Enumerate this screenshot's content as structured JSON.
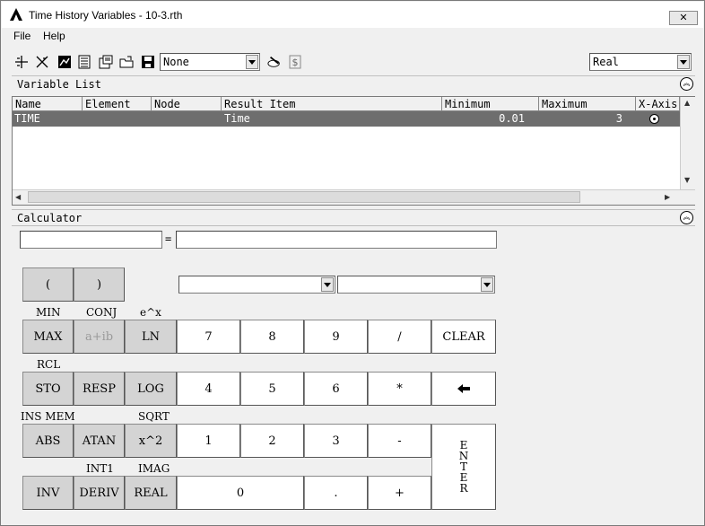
{
  "window": {
    "title": "Time History Variables - 10-3.rth",
    "close_glyph": "✕"
  },
  "menu": {
    "items": [
      "File",
      "Help"
    ]
  },
  "toolbar": {
    "variable_select": "None",
    "mode_select": "Real",
    "icons": [
      "add-variable-icon",
      "delete-variable-icon",
      "graph-icon",
      "list-icon",
      "properties-icon",
      "import-icon",
      "save-icon",
      "edit-icon",
      "dollar-icon"
    ]
  },
  "variable_list": {
    "header": "Variable List",
    "columns": [
      "Name",
      "Element",
      "Node",
      "Result Item",
      "Minimum",
      "Maximum",
      "X-Axis"
    ],
    "rows": [
      {
        "name": "TIME",
        "element": "",
        "node": "",
        "result_item": "Time",
        "minimum": "0.01",
        "maximum": "3",
        "x_axis": true
      }
    ]
  },
  "calculator": {
    "header": "Calculator",
    "expression_value": "",
    "equals_sign": "=",
    "result_value": "",
    "selector_left": "",
    "selector_right": "",
    "keys": {
      "lparen": "(",
      "rparen": ")",
      "max": "MAX",
      "aib": "a+ib",
      "ln": "LN",
      "sto": "STO",
      "resp": "RESP",
      "log": "LOG",
      "abs": "ABS",
      "atan": "ATAN",
      "x2": "x^2",
      "inv": "INV",
      "deriv": "DERIV",
      "real": "REAL",
      "n7": "7",
      "n8": "8",
      "n9": "9",
      "div": "/",
      "clear": "CLEAR",
      "n4": "4",
      "n5": "5",
      "n6": "6",
      "mul": "*",
      "n1": "1",
      "n2": "2",
      "n3": "3",
      "minus": "-",
      "n0": "0",
      "dot": ".",
      "plus": "+",
      "enter": [
        "E",
        "N",
        "T",
        "E",
        "R"
      ]
    },
    "shift_labels": {
      "min": "MIN",
      "conj": "CONJ",
      "ex": "e^x",
      "rcl": "RCL",
      "insmem": "INS MEM",
      "sqrt": "SQRT",
      "int1": "INT1",
      "imag": "IMAG"
    }
  }
}
